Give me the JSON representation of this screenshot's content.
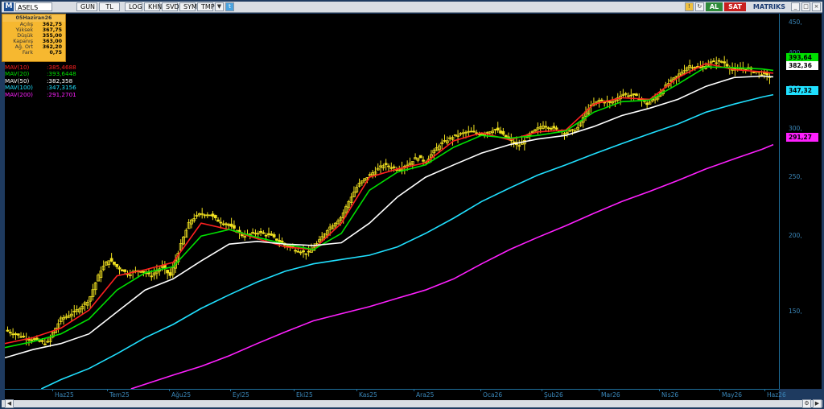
{
  "toolbar": {
    "logo": "M",
    "symbol": "ASELS",
    "buttons": [
      "GUN",
      "TL",
      "LOG",
      "KHN",
      "SVD",
      "SYM",
      "TMP"
    ],
    "al_label": "AL",
    "sat_label": "SAT",
    "matriks_label": "MATRIKS"
  },
  "info_box": {
    "date": "05Haziran26",
    "rows": [
      {
        "label": "Açılış",
        "value": "362,75"
      },
      {
        "label": "Yüksek",
        "value": "367,75"
      },
      {
        "label": "Düşük",
        "value": "355,00"
      },
      {
        "label": "Kapanış",
        "value": "363,00"
      },
      {
        "label": "Ağ. Ort",
        "value": "362,20"
      },
      {
        "label": "Fark",
        "value": "0,75"
      }
    ]
  },
  "mav_legend": [
    {
      "name": "MAV(10)",
      "value": ":385,4688",
      "color": "#ff2020"
    },
    {
      "name": "MAV(20)",
      "value": ":393,6448",
      "color": "#00e000"
    },
    {
      "name": "MAV(50)",
      "value": ":382,358",
      "color": "#ffffff"
    },
    {
      "name": "MAV(100)",
      "value": ":347,3156",
      "color": "#20e0ff"
    },
    {
      "name": "MAV(200)",
      "value": ":291,2701",
      "color": "#ff20ff"
    }
  ],
  "price_tags": [
    {
      "text": "393,64",
      "price": 393.64,
      "bg": "#00e000"
    },
    {
      "text": "382,36",
      "price": 382.36,
      "bg": "#ffffff"
    },
    {
      "text": "347,32",
      "price": 347.32,
      "bg": "#20e0ff"
    },
    {
      "text": "291,27",
      "price": 291.27,
      "bg": "#ff20ff"
    }
  ],
  "chart_data": {
    "type": "candlestick",
    "symbol": "ASELS",
    "y_scale": "log",
    "ylim": [
      112,
      465
    ],
    "yticks": [
      {
        "value": 450,
        "label": "450,"
      },
      {
        "value": 400,
        "label": "400,"
      },
      {
        "value": 350,
        "label": "350,"
      },
      {
        "value": 300,
        "label": "300,"
      },
      {
        "value": 250,
        "label": "250,"
      },
      {
        "value": 200,
        "label": "200,"
      },
      {
        "value": 150,
        "label": "150,"
      }
    ],
    "xticks": [
      "Haz25",
      "Tem25",
      "Ağu25",
      "Eyl25",
      "Eki25",
      "Kas25",
      "Ara25",
      "Oca26",
      "Şub26",
      "Mar26",
      "Nis26",
      "May26",
      "Haz26"
    ],
    "price_path": [
      [
        0,
        140
      ],
      [
        0.5,
        137
      ],
      [
        1,
        135
      ],
      [
        1.5,
        133
      ],
      [
        2,
        146
      ],
      [
        2.5,
        150
      ],
      [
        3,
        157
      ],
      [
        3.4,
        175
      ],
      [
        3.7,
        183
      ],
      [
        4,
        178
      ],
      [
        4.4,
        173
      ],
      [
        4.8,
        176
      ],
      [
        5.2,
        172
      ],
      [
        5.6,
        178
      ],
      [
        5.9,
        172
      ],
      [
        6.3,
        195
      ],
      [
        6.6,
        212
      ],
      [
        7,
        218
      ],
      [
        7.3,
        217
      ],
      [
        7.6,
        212
      ],
      [
        8,
        208
      ],
      [
        8.5,
        200
      ],
      [
        9,
        203
      ],
      [
        9.5,
        200
      ],
      [
        10,
        193
      ],
      [
        10.5,
        189
      ],
      [
        10.8,
        187
      ],
      [
        11.2,
        196
      ],
      [
        11.5,
        205
      ],
      [
        12,
        215
      ],
      [
        12.3,
        230
      ],
      [
        12.6,
        243
      ],
      [
        13,
        252
      ],
      [
        13.5,
        262
      ],
      [
        14,
        258
      ],
      [
        14.4,
        263
      ],
      [
        14.7,
        270
      ],
      [
        15,
        265
      ],
      [
        15.5,
        283
      ],
      [
        16,
        292
      ],
      [
        16.5,
        297
      ],
      [
        17,
        295
      ],
      [
        17.5,
        300
      ],
      [
        17.9,
        290
      ],
      [
        18.3,
        281
      ],
      [
        18.7,
        294
      ],
      [
        19.2,
        305
      ],
      [
        19.6,
        300
      ],
      [
        20,
        296
      ],
      [
        20.4,
        300
      ],
      [
        20.8,
        325
      ],
      [
        21.2,
        335
      ],
      [
        21.6,
        331
      ],
      [
        22,
        343
      ],
      [
        22.5,
        340
      ],
      [
        22.9,
        330
      ],
      [
        23.2,
        338
      ],
      [
        23.6,
        355
      ],
      [
        24,
        368
      ],
      [
        24.4,
        382
      ],
      [
        24.8,
        378
      ],
      [
        25.2,
        387
      ],
      [
        25.6,
        388
      ],
      [
        26,
        373
      ],
      [
        26.3,
        379
      ],
      [
        26.6,
        375
      ],
      [
        27,
        370
      ],
      [
        27.4,
        364
      ]
    ],
    "series": [
      {
        "name": "MAV(10)",
        "color": "#ff2020",
        "points": [
          [
            0,
            133
          ],
          [
            1,
            136
          ],
          [
            2,
            141
          ],
          [
            3,
            151
          ],
          [
            4,
            172
          ],
          [
            5,
            176
          ],
          [
            6,
            181
          ],
          [
            7,
            210
          ],
          [
            8,
            205
          ],
          [
            9,
            198
          ],
          [
            10,
            192
          ],
          [
            11,
            190
          ],
          [
            12,
            210
          ],
          [
            13,
            250
          ],
          [
            14,
            258
          ],
          [
            15,
            264
          ],
          [
            16,
            287
          ],
          [
            17,
            296
          ],
          [
            18,
            288
          ],
          [
            19,
            297
          ],
          [
            20,
            299
          ],
          [
            21,
            330
          ],
          [
            22,
            338
          ],
          [
            23,
            336
          ],
          [
            24,
            365
          ],
          [
            25,
            385
          ],
          [
            26,
            376
          ],
          [
            27,
            373
          ],
          [
            27.4,
            371
          ]
        ]
      },
      {
        "name": "MAV(20)",
        "color": "#00e000",
        "points": [
          [
            0,
            131
          ],
          [
            1,
            134
          ],
          [
            2,
            138
          ],
          [
            3,
            146
          ],
          [
            4,
            163
          ],
          [
            5,
            174
          ],
          [
            6,
            178
          ],
          [
            7,
            200
          ],
          [
            8,
            205
          ],
          [
            9,
            199
          ],
          [
            10,
            194
          ],
          [
            11,
            190
          ],
          [
            12,
            202
          ],
          [
            13,
            238
          ],
          [
            14,
            255
          ],
          [
            15,
            262
          ],
          [
            16,
            280
          ],
          [
            17,
            293
          ],
          [
            18,
            290
          ],
          [
            19,
            293
          ],
          [
            20,
            298
          ],
          [
            21,
            320
          ],
          [
            22,
            333
          ],
          [
            23,
            335
          ],
          [
            24,
            356
          ],
          [
            25,
            380
          ],
          [
            26,
            379
          ],
          [
            27,
            377
          ],
          [
            27.4,
            375
          ]
        ]
      },
      {
        "name": "MAV(50)",
        "color": "#ffffff",
        "points": [
          [
            0,
            126
          ],
          [
            1,
            130
          ],
          [
            2,
            133
          ],
          [
            3,
            138
          ],
          [
            4,
            150
          ],
          [
            5,
            163
          ],
          [
            6,
            170
          ],
          [
            7,
            182
          ],
          [
            8,
            194
          ],
          [
            9,
            196
          ],
          [
            10,
            194
          ],
          [
            11,
            193
          ],
          [
            12,
            195
          ],
          [
            13,
            210
          ],
          [
            14,
            232
          ],
          [
            15,
            250
          ],
          [
            16,
            262
          ],
          [
            17,
            274
          ],
          [
            18,
            283
          ],
          [
            19,
            289
          ],
          [
            20,
            293
          ],
          [
            21,
            303
          ],
          [
            22,
            316
          ],
          [
            23,
            325
          ],
          [
            24,
            336
          ],
          [
            25,
            353
          ],
          [
            26,
            365
          ],
          [
            27,
            367
          ],
          [
            27.4,
            366
          ]
        ]
      },
      {
        "name": "MAV(100)",
        "color": "#20e0ff",
        "points": [
          [
            1.3,
            112
          ],
          [
            2,
            116
          ],
          [
            3,
            121
          ],
          [
            4,
            128
          ],
          [
            5,
            136
          ],
          [
            6,
            143
          ],
          [
            7,
            152
          ],
          [
            8,
            160
          ],
          [
            9,
            168
          ],
          [
            10,
            175
          ],
          [
            11,
            180
          ],
          [
            12,
            183
          ],
          [
            13,
            186
          ],
          [
            14,
            192
          ],
          [
            15,
            202
          ],
          [
            16,
            214
          ],
          [
            17,
            228
          ],
          [
            18,
            240
          ],
          [
            19,
            252
          ],
          [
            20,
            262
          ],
          [
            21,
            273
          ],
          [
            22,
            284
          ],
          [
            23,
            295
          ],
          [
            24,
            306
          ],
          [
            25,
            320
          ],
          [
            26,
            330
          ],
          [
            27,
            339
          ],
          [
            27.4,
            342
          ]
        ]
      },
      {
        "name": "MAV(200)",
        "color": "#ff20ff",
        "points": [
          [
            4.5,
            112
          ],
          [
            5,
            114
          ],
          [
            6,
            118
          ],
          [
            7,
            122
          ],
          [
            8,
            127
          ],
          [
            9,
            133
          ],
          [
            10,
            139
          ],
          [
            11,
            145
          ],
          [
            12,
            149
          ],
          [
            13,
            153
          ],
          [
            14,
            158
          ],
          [
            15,
            163
          ],
          [
            16,
            170
          ],
          [
            17,
            180
          ],
          [
            18,
            190
          ],
          [
            19,
            199
          ],
          [
            20,
            208
          ],
          [
            21,
            218
          ],
          [
            22,
            228
          ],
          [
            23,
            237
          ],
          [
            24,
            247
          ],
          [
            25,
            258
          ],
          [
            26,
            268
          ],
          [
            27,
            278
          ],
          [
            27.4,
            283
          ]
        ]
      }
    ]
  }
}
